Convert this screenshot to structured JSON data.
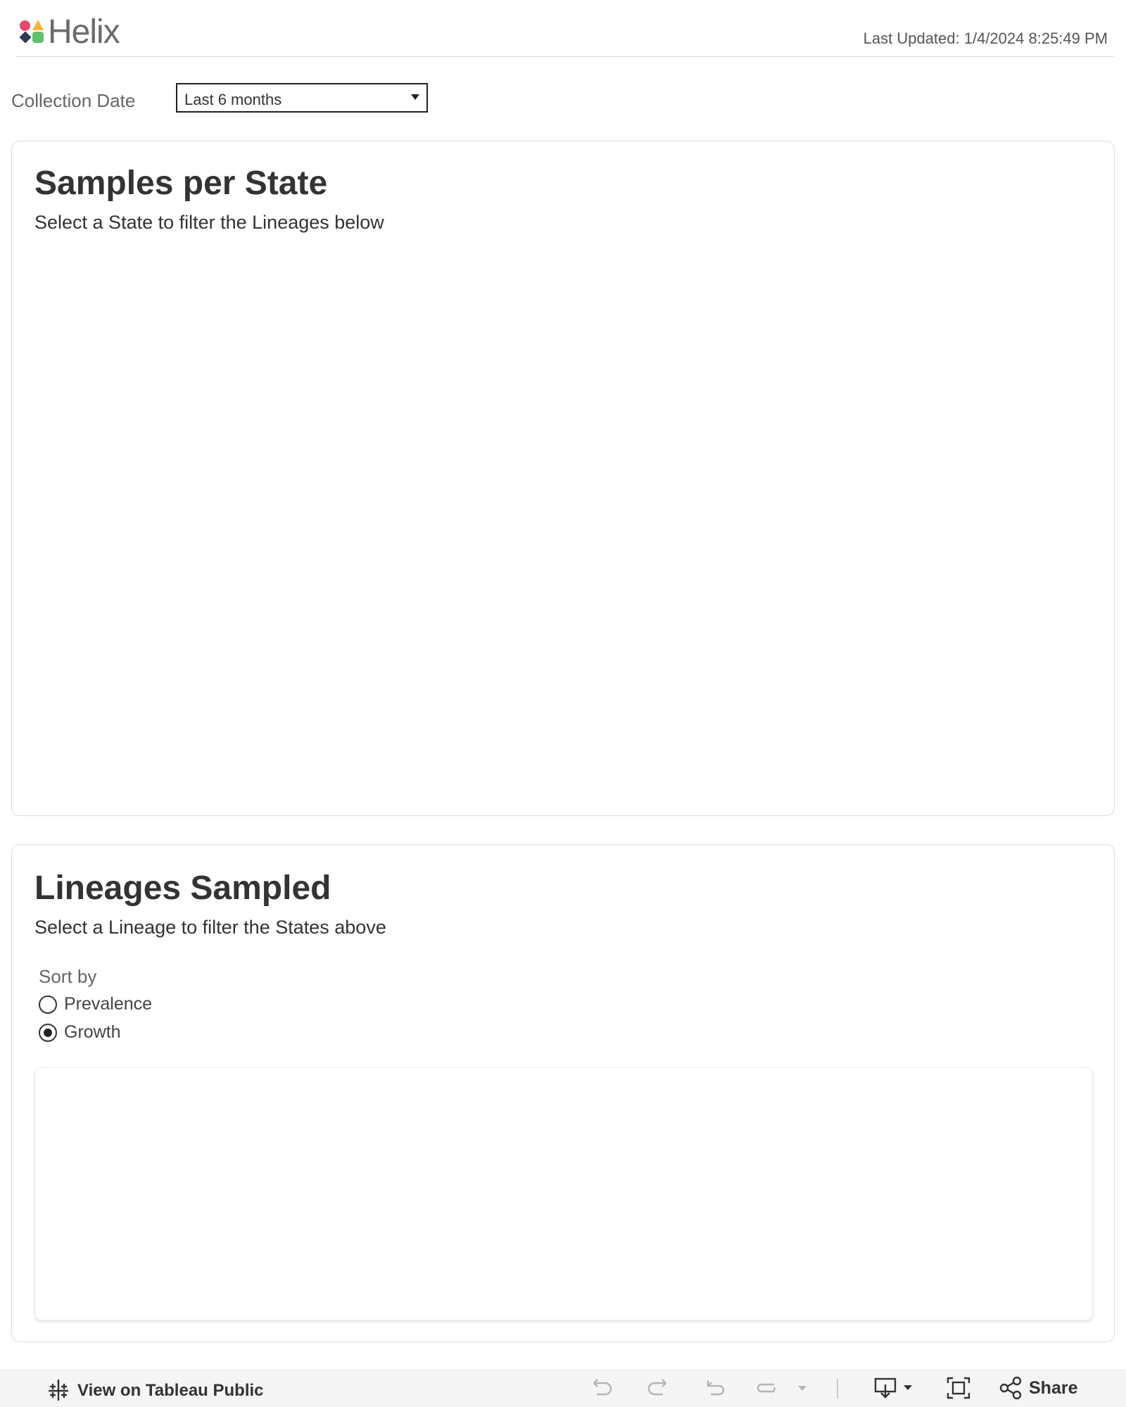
{
  "header": {
    "logo_text": "Helix",
    "last_updated": "Last Updated: 1/4/2024 8:25:49 PM"
  },
  "filter": {
    "label": "Collection Date",
    "value": "Last 6 months"
  },
  "samples_card": {
    "title": "Samples per State",
    "subtitle": "Select a State to filter the Lineages below"
  },
  "lineages_card": {
    "title": "Lineages Sampled",
    "subtitle": "Select a Lineage to filter the States above",
    "sort_label": "Sort by",
    "sort_options": [
      {
        "label": "Prevalence",
        "checked": false
      },
      {
        "label": "Growth",
        "checked": true
      }
    ]
  },
  "toolbar": {
    "view_label": "View on Tableau Public",
    "share_label": "Share"
  },
  "colors": {
    "logo_pink": "#e8476a",
    "logo_yellow": "#f4b63e",
    "logo_navy": "#2c3a55",
    "logo_green": "#62bf6a",
    "toolbar_bg": "#f5f5f5"
  }
}
